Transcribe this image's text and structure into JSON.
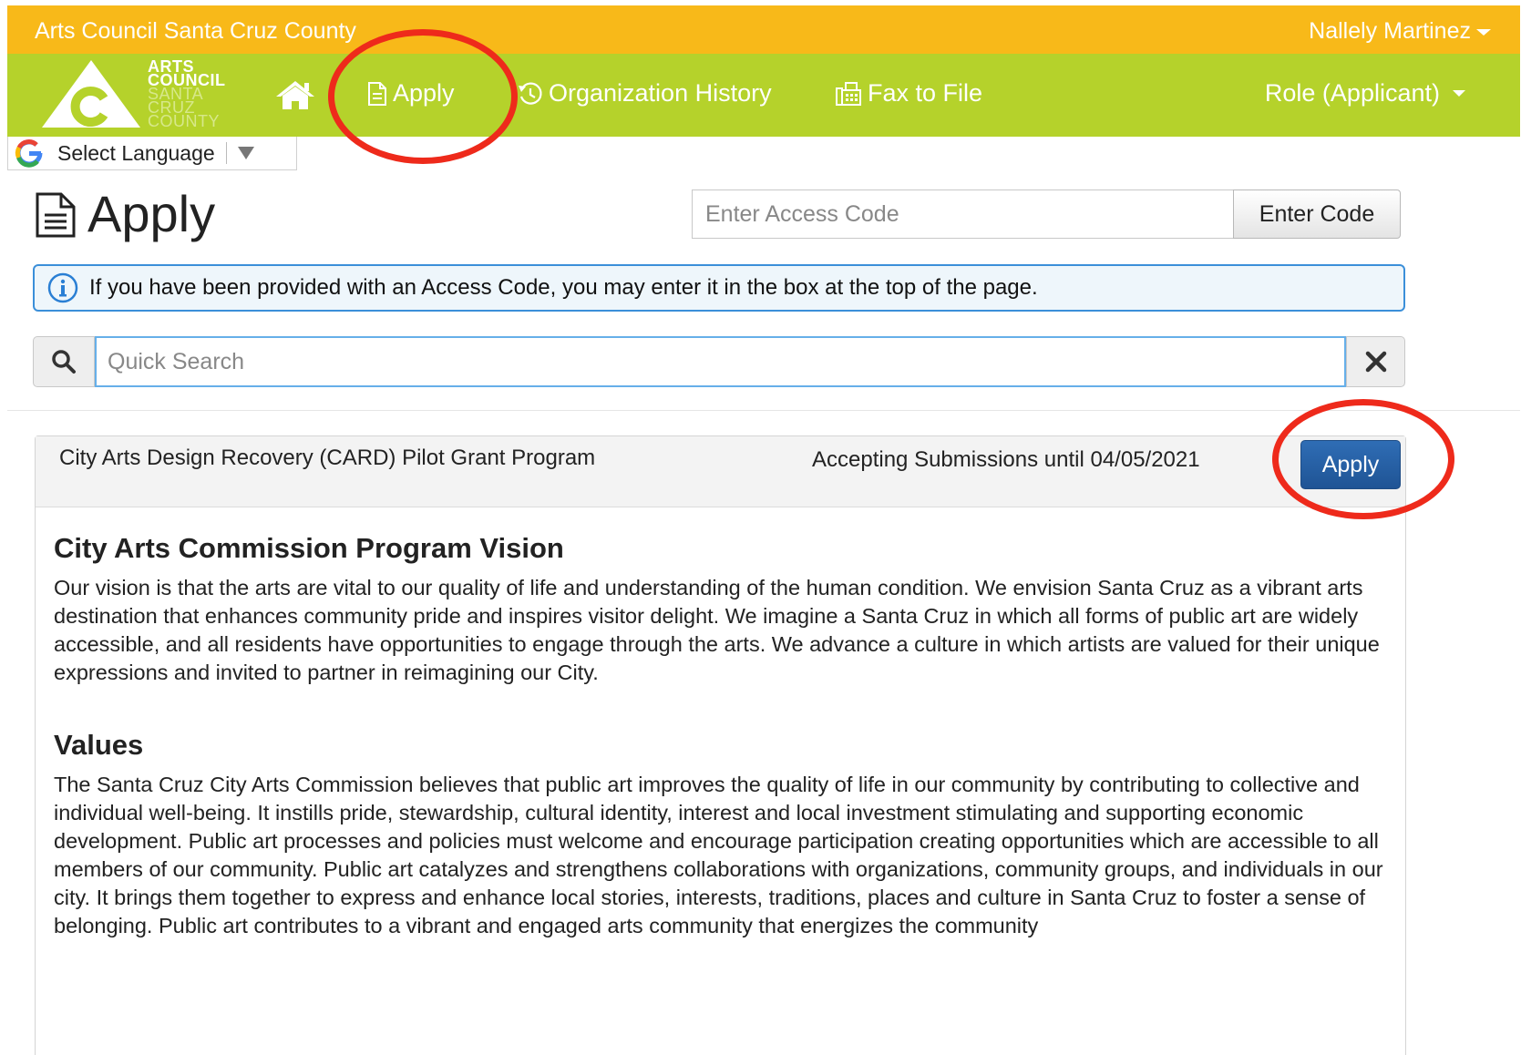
{
  "topbar": {
    "org_name": "Arts Council Santa Cruz County",
    "user_name": "Nallely Martinez"
  },
  "logo": {
    "line1": "ARTS",
    "line2": "COUNCIL",
    "line3": "SANTA",
    "line4": "CRUZ",
    "line5": "COUNTY"
  },
  "nav": {
    "home_icon": "home-icon",
    "apply_label": "Apply",
    "history_label": "Organization History",
    "fax_label": "Fax to File",
    "role_label": "Role (Applicant)"
  },
  "language": {
    "label": "Select Language"
  },
  "page": {
    "title": "Apply",
    "access_code_placeholder": "Enter Access Code",
    "enter_code_label": "Enter Code",
    "info_message": "If you have been provided with an Access Code, you may enter it in the box at the top of the page.",
    "search_placeholder": "Quick Search"
  },
  "program": {
    "name": "City Arts Design Recovery (CARD) Pilot Grant Program",
    "deadline": "Accepting Submissions until 04/05/2021",
    "apply_label": "Apply",
    "vision_title": "City Arts Commission Program Vision",
    "vision_text": "Our vision is that the arts are vital to our quality of life and understanding of the human condition. We envision Santa Cruz as a vibrant arts destination that enhances community pride and inspires visitor delight. We imagine a Santa Cruz in which all forms of public art are widely accessible, and all residents have opportunities to engage through the arts. We advance a culture in which artists are valued for their unique expressions and invited to partner in reimagining our City.",
    "values_title": "Values",
    "values_text": "The Santa Cruz City Arts Commission believes that public art improves the quality of life in our community by contributing to collective and individual well-being. It instills pride, stewardship, cultural identity, interest and local investment stimulating and supporting economic development. Public art processes and policies must welcome and encourage participation creating opportunities which are accessible to all members of our community. Public art catalyzes and strengthens collaborations with organizations, community groups, and individuals in our city. It brings them together to express and enhance local stories, interests, traditions, places and culture in Santa Cruz to foster a sense of belonging. Public art contributes to a vibrant and engaged arts community that energizes the community"
  },
  "colors": {
    "topbar": "#f8b919",
    "navbar": "#b5d22b",
    "primary_button": "#2462a8",
    "annotation": "#ee2a1b",
    "info_border": "#3b8fd9"
  }
}
